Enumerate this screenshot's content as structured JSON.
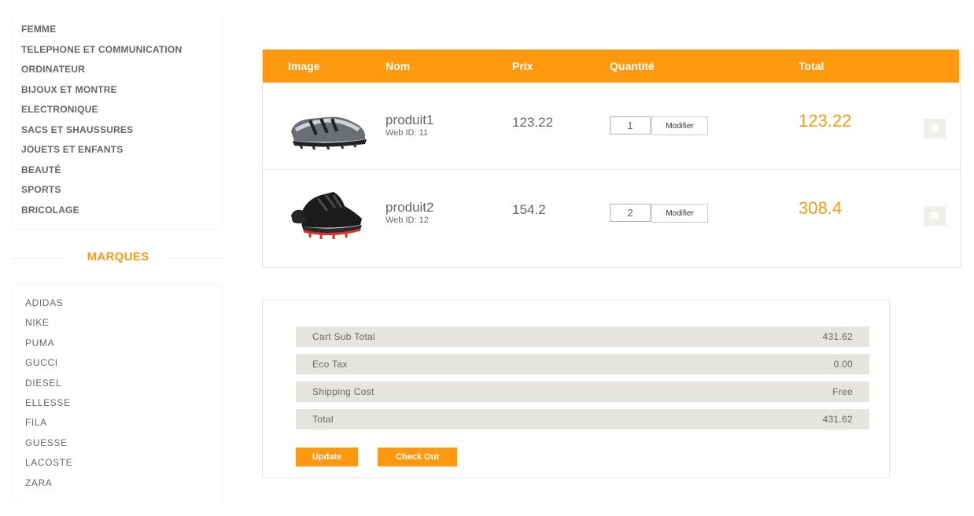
{
  "sidebar": {
    "categories": [
      "FEMME",
      "TELEPHONE ET COMMUNICATION",
      "ORDINATEUR",
      "BIJOUX ET MONTRE",
      "ELECTRONIQUE",
      "SACS ET SHAUSSURES",
      "JOUETS ET ENFANTS",
      "BEAUTÉ",
      "SPORTS",
      "BRICOLAGE"
    ],
    "brands_heading": "MARQUES",
    "brands": [
      "ADIDAS",
      "NIKE",
      "PUMA",
      "GUCCI",
      "DIESEL",
      "ELLESSE",
      "FILA",
      "GUESSE",
      "LACOSTE",
      "ZARA"
    ]
  },
  "cart": {
    "headers": {
      "image": "Image",
      "name": "Nom",
      "price": "Prix",
      "quantity": "Quantité",
      "total": "Total"
    },
    "items": [
      {
        "name": "produit1",
        "web_id": "Web ID: 11",
        "price": "123.22",
        "quantity": "1",
        "update_label": "Modifier",
        "total": "123.22",
        "delete_icon": "close-icon",
        "image_icon": "shoe-image-grey"
      },
      {
        "name": "produit2",
        "web_id": "Web ID: 12",
        "price": "154.2",
        "quantity": "2",
        "update_label": "Modifier",
        "total": "308.4",
        "delete_icon": "close-icon",
        "image_icon": "shoe-image-black-red"
      }
    ]
  },
  "summary": {
    "rows": [
      {
        "label": "Cart Sub Total",
        "value": "431.62"
      },
      {
        "label": "Eco Tax",
        "value": "0.00"
      },
      {
        "label": "Shipping Cost",
        "value": "Free"
      },
      {
        "label": "Total",
        "value": "431.62"
      }
    ],
    "update_label": "Update",
    "checkout_label": "Check Out"
  },
  "colors": {
    "accent": "#fe980f",
    "row_bg": "#e6e4df",
    "text": "#696763"
  }
}
